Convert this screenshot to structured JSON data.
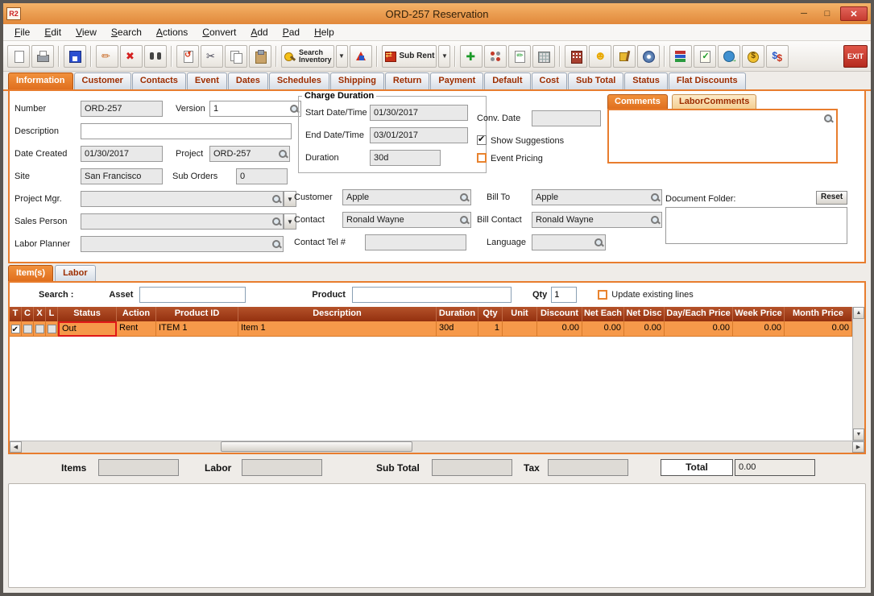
{
  "window": {
    "title": "ORD-257 Reservation",
    "app_badge": "R2"
  },
  "menu": {
    "items": [
      "File",
      "Edit",
      "View",
      "Search",
      "Actions",
      "Convert",
      "Add",
      "Pad",
      "Help"
    ]
  },
  "toolbar": {
    "search_inventory": {
      "line1": "Search",
      "line2": "Inventory"
    },
    "sub_rent_label": "Sub Rent",
    "exit_label": "EXIT",
    "icons": [
      "new-document",
      "print",
      "save",
      "edit-pencil",
      "delete",
      "find-binoculars",
      "revert-document",
      "cut",
      "copy",
      "paste",
      "search-inventory",
      "inventory-dropdown",
      "item-types",
      "sub-rent",
      "sub-rent-dropdown",
      "add-line",
      "groups",
      "edit-lines",
      "grid-view",
      "warehouse",
      "contacts-smiley",
      "equipment-dolly",
      "disc",
      "catalog-books",
      "document-check",
      "web-globe",
      "money",
      "currency-exchange",
      "exit"
    ]
  },
  "tabs": {
    "selected": "Information",
    "items": [
      "Information",
      "Customer",
      "Contacts",
      "Event",
      "Dates",
      "Schedules",
      "Shipping",
      "Return",
      "Payment",
      "Default",
      "Cost",
      "Sub Total",
      "Status",
      "Flat Discounts"
    ]
  },
  "info": {
    "number_label": "Number",
    "number_value": "ORD-257",
    "version_label": "Version",
    "version_value": "1",
    "description_label": "Description",
    "description_value": "",
    "date_created_label": "Date Created",
    "date_created_value": "01/30/2017",
    "project_label": "Project",
    "project_value": "ORD-257",
    "site_label": "Site",
    "site_value": "San Francisco",
    "sub_orders_label": "Sub Orders",
    "sub_orders_value": "0",
    "project_mgr_label": "Project Mgr.",
    "project_mgr_value": "",
    "sales_person_label": "Sales Person",
    "sales_person_value": "",
    "labor_planner_label": "Labor Planner",
    "labor_planner_value": "",
    "charge_duration_title": "Charge Duration",
    "start_label": "Start Date/Time",
    "start_value": "01/30/2017",
    "end_label": "End Date/Time",
    "end_value": "03/01/2017",
    "duration_label": "Duration",
    "duration_value": "30d",
    "conv_date_label": "Conv. Date",
    "conv_date_value": "",
    "show_suggestions_label": "Show Suggestions",
    "show_suggestions_checked": true,
    "event_pricing_label": "Event Pricing",
    "event_pricing_checked": false,
    "customer_label": "Customer",
    "customer_value": "Apple",
    "bill_to_label": "Bill To",
    "bill_to_value": "Apple",
    "contact_label": "Contact",
    "contact_value": "Ronald Wayne",
    "bill_contact_label": "Bill Contact",
    "bill_contact_value": "Ronald Wayne",
    "contact_tel_label": "Contact Tel #",
    "contact_tel_value": "",
    "language_label": "Language",
    "language_value": ""
  },
  "comments": {
    "tabs": [
      "Comments",
      "LaborComments"
    ],
    "selected": "Comments",
    "value": "",
    "document_folder_label": "Document Folder:",
    "document_folder_value": "",
    "reset_label": "Reset"
  },
  "items_section": {
    "tabs": [
      "Item(s)",
      "Labor"
    ],
    "selected_tab": "Item(s)",
    "search_label": "Search :",
    "asset_label": "Asset",
    "asset_value": "",
    "product_label": "Product",
    "product_value": "",
    "qty_label": "Qty",
    "qty_value": "1",
    "update_lines_label": "Update existing lines",
    "update_lines_checked": false,
    "table": {
      "columns": [
        "T",
        "C",
        "X",
        "L",
        "Status",
        "Action",
        "Product ID",
        "Description",
        "Duration",
        "Qty",
        "Unit",
        "Discount",
        "Net Each",
        "Net Disc",
        "Day/Each Price",
        "Week Price",
        "Month Price"
      ],
      "rows": [
        {
          "t_checked": true,
          "c_checked": false,
          "x_checked": false,
          "l_checked": false,
          "status": "Out",
          "action": "Rent",
          "product_id": "ITEM 1",
          "description": "Item 1",
          "duration": "30d",
          "qty": "1",
          "unit": "",
          "discount": "0.00",
          "net_each": "0.00",
          "net_disc": "0.00",
          "day_each_price": "0.00",
          "week_price": "0.00",
          "month_price": "0.00"
        }
      ]
    }
  },
  "summary": {
    "items_label": "Items",
    "items_value": "",
    "labor_label": "Labor",
    "labor_value": "",
    "sub_total_label": "Sub Total",
    "sub_total_value": "",
    "tax_label": "Tax",
    "tax_value": "",
    "total_label": "Total",
    "total_value": "0.00"
  },
  "colors": {
    "accent_orange": "#E87D2E",
    "selected_tab_orange": "#E06F1E",
    "table_header_red": "#9E3A14",
    "row_orange": "#F6994A",
    "tab_text_red": "#9C2D00",
    "close_button_red": "#C63B30",
    "status_cell_border": "#E01818"
  }
}
